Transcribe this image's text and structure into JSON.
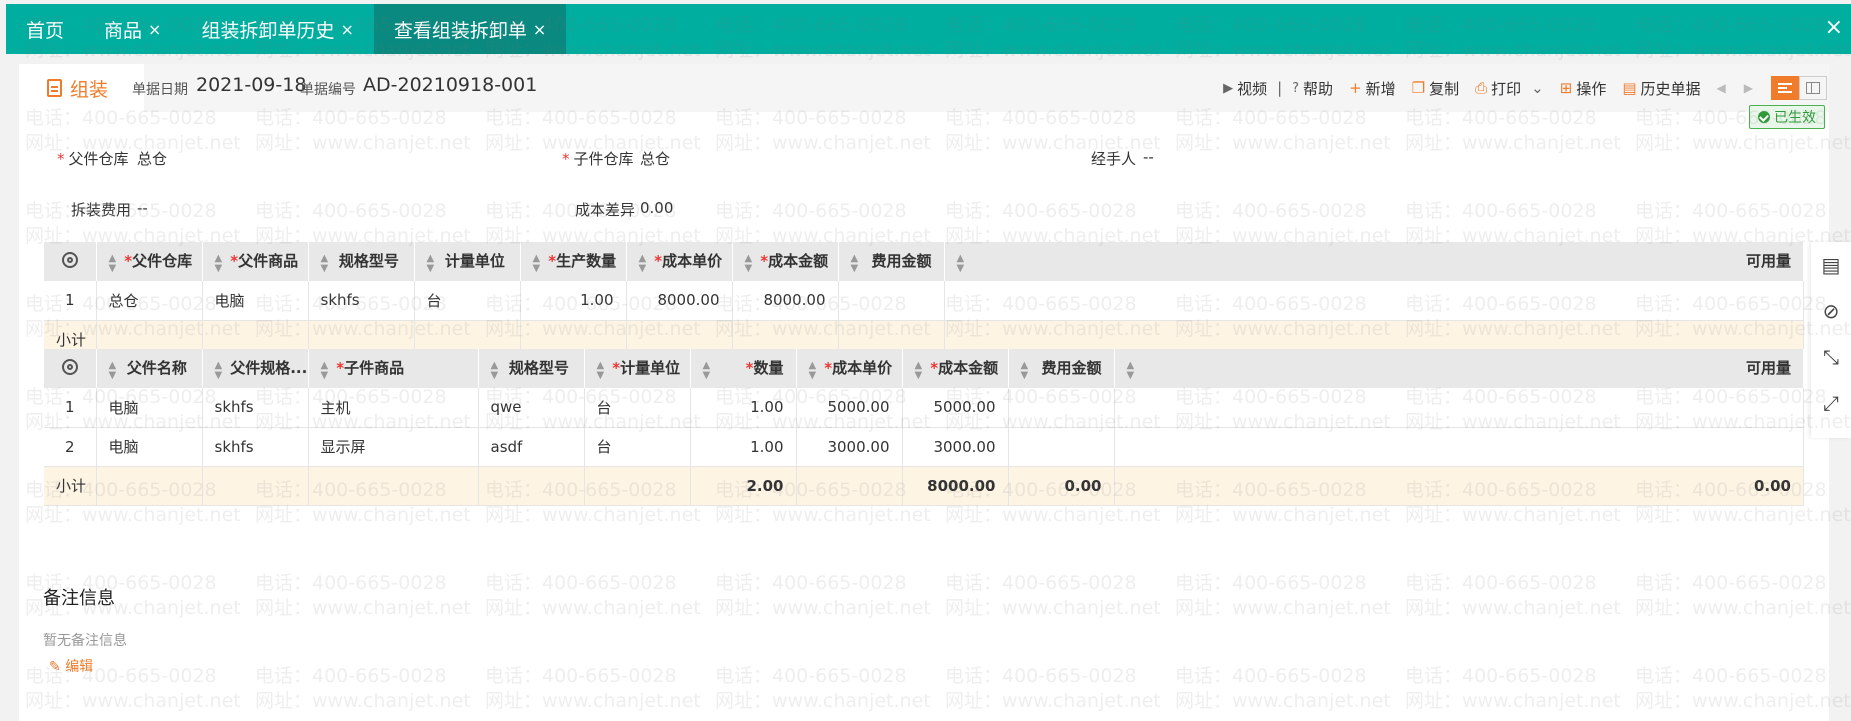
{
  "tabs": [
    {
      "label": "首页",
      "closable": false
    },
    {
      "label": "商品",
      "closable": true
    },
    {
      "label": "组装拆卸单历史",
      "closable": true
    },
    {
      "label": "查看组装拆卸单",
      "closable": true
    }
  ],
  "close_glyph": "×",
  "doc": {
    "tab_label": "组装",
    "date_label": "单据日期",
    "date_value": "2021-09-18",
    "no_label": "单据编号",
    "no_value": "AD-20210918-001",
    "status": "已生效"
  },
  "toolbar": {
    "video": "视频",
    "help": "帮助",
    "add": "新增",
    "copy": "复制",
    "print": "打印",
    "ops": "操作",
    "history": "历史单据"
  },
  "form": {
    "parent_wh_label": "父件仓库",
    "parent_wh_value": "总仓",
    "child_wh_label": "子件仓库",
    "child_wh_value": "总仓",
    "handler_label": "经手人",
    "handler_value": "--",
    "fee_label": "拆装费用",
    "fee_value": "--",
    "diff_label": "成本差异",
    "diff_value": "0.00"
  },
  "parent_table": {
    "headers": [
      "父件仓库",
      "父件商品",
      "规格型号",
      "计量单位",
      "生产数量",
      "成本单价",
      "成本金额",
      "费用金额",
      "可用量"
    ],
    "rows": [
      [
        "1",
        "总仓",
        "电脑",
        "skhfs",
        "台",
        "1.00",
        "8000.00",
        "8000.00",
        "",
        ""
      ]
    ],
    "subtotal_label": "小计"
  },
  "child_table": {
    "headers": [
      "父件名称",
      "父件规格...",
      "子件商品",
      "规格型号",
      "计量单位",
      "数量",
      "成本单价",
      "成本金额",
      "费用金额",
      "可用量"
    ],
    "rows": [
      [
        "1",
        "电脑",
        "skhfs",
        "主机",
        "qwe",
        "台",
        "1.00",
        "5000.00",
        "5000.00",
        "",
        ""
      ],
      [
        "2",
        "电脑",
        "skhfs",
        "显示屏",
        "asdf",
        "台",
        "1.00",
        "3000.00",
        "3000.00",
        "",
        ""
      ]
    ],
    "subtotal": {
      "label": "小计",
      "qty": "2.00",
      "amount": "8000.00",
      "fee": "0.00",
      "avail": "0.00"
    }
  },
  "remark": {
    "title": "备注信息",
    "empty": "暂无备注信息",
    "edit": "编辑"
  },
  "watermark": {
    "phone": "电话：400-665-0028",
    "site": "网址：www.chanjet.net"
  },
  "colors": {
    "teal": "#00aea0",
    "teal_dark": "#09897f",
    "accent": "#f07c2b",
    "required": "#e53935"
  }
}
